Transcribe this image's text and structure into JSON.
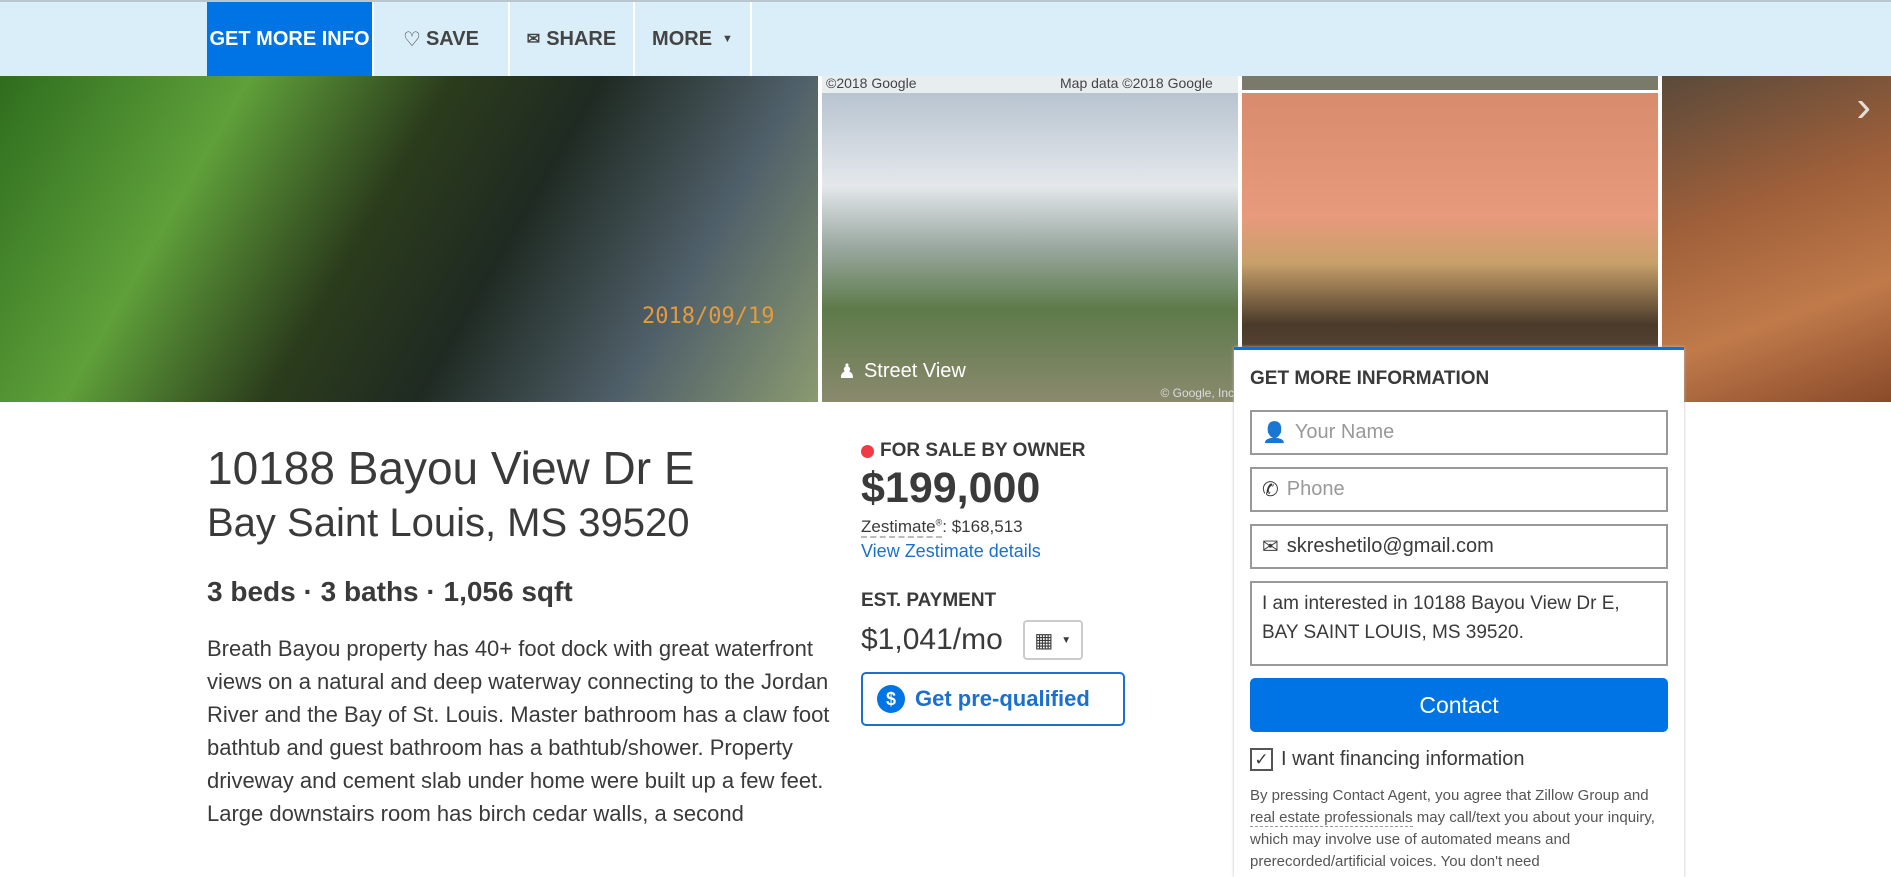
{
  "nav": {
    "get_more_info": "GET MORE INFO",
    "save": "SAVE",
    "share": "SHARE",
    "more": "MORE"
  },
  "photos": {
    "date_stamp": "2018/09/19",
    "map_credit_left": "©2018 Google",
    "map_credit_right": "Map data ©2018 Google",
    "street_view": "Street View",
    "google_credit": "© Google, Inc"
  },
  "listing": {
    "address_line1": "10188 Bayou View Dr E",
    "address_line2": "Bay Saint Louis, MS 39520",
    "facts": "3 beds · 3 baths · 1,056 sqft",
    "description": "Breath Bayou property has 40+ foot dock with great waterfront views on a natural and deep waterway connecting to the Jordan River and the Bay of St. Louis. Master bathroom has a claw foot bathtub and guest bathroom has a bathtub/shower. Property driveway and cement slab under home were built up a few feet. Large downstairs room has birch cedar walls, a second"
  },
  "price": {
    "status": "FOR SALE BY OWNER",
    "status_color": "#ef3b46",
    "price": "$199,000",
    "zestimate_label": "Zestimate",
    "zestimate_sup": "®",
    "zestimate_value": ": $168,513",
    "zestimate_link": "View Zestimate details",
    "est_label": "EST. PAYMENT",
    "est_value": "$1,041/mo",
    "prequalify": "Get pre-qualified"
  },
  "form": {
    "title": "GET MORE INFORMATION",
    "name_placeholder": "Your Name",
    "phone_placeholder": "Phone",
    "email_value": "skreshetilo@gmail.com",
    "message": "I am interested in 10188 Bayou View Dr E, BAY SAINT LOUIS, MS 39520.",
    "contact": "Contact",
    "financing_label": "I want financing information",
    "financing_checked": true,
    "legal_1": "By pressing Contact Agent, you agree that Zillow Group and ",
    "legal_link": "real estate professionals",
    "legal_2": " may call/text you about your inquiry, which may involve use of automated means and prerecorded/artificial voices. You don't need"
  },
  "accent": "#0074e4"
}
